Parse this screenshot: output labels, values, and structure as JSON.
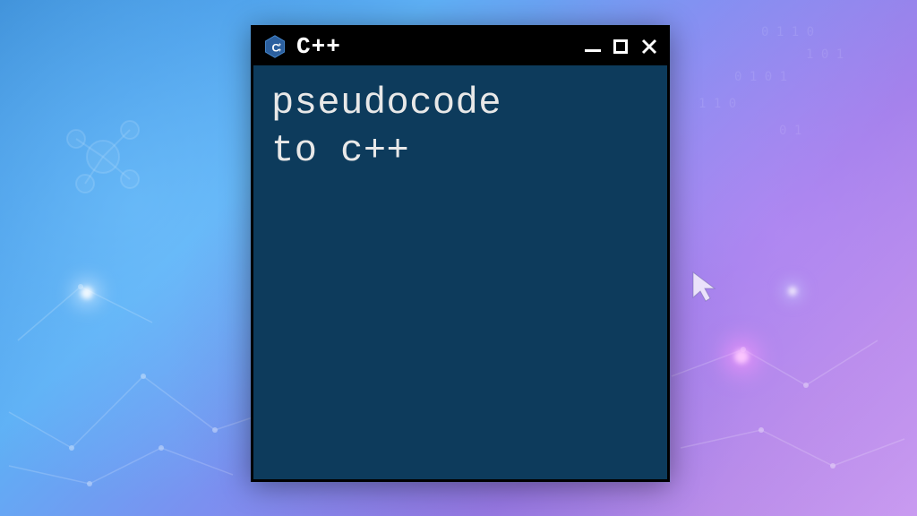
{
  "window": {
    "title": "C++",
    "icon_letter": "C",
    "icon_plus": "++"
  },
  "content": {
    "line1": "pseudocode",
    "line2": "to c++"
  }
}
